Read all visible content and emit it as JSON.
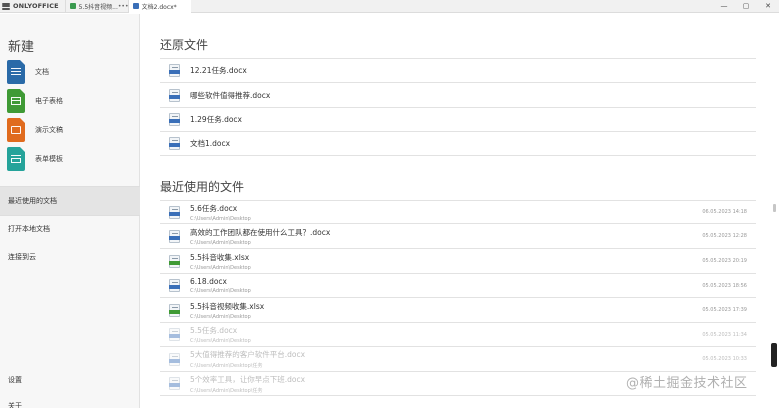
{
  "titlebar": {
    "brand": "ONLYOFFICE",
    "tabs": [
      {
        "label": "5.5抖音视频...",
        "close": "•••",
        "color": "#3a9a4f"
      },
      {
        "label": "文档2.docx*",
        "color": "#3a6fb8"
      }
    ],
    "window_controls": [
      "—",
      "▢",
      "✕"
    ]
  },
  "sidebar": {
    "title": "新建",
    "create_items": [
      {
        "label": "文档",
        "color": "#2a6aa8"
      },
      {
        "label": "电子表格",
        "color": "#3f9a35"
      },
      {
        "label": "演示文稿",
        "color": "#e06b1e"
      },
      {
        "label": "表单模板",
        "color": "#25a39a"
      }
    ],
    "nav": {
      "recent": "最近使用的文档",
      "open_local": "打开本地文档",
      "connect_cloud": "连接到云",
      "settings": "设置",
      "about": "关于"
    }
  },
  "main": {
    "restore_title": "还原文件",
    "restore_files": [
      {
        "name": "12.21任务.docx"
      },
      {
        "name": "哪些软件值得推荐.docx"
      },
      {
        "name": "1.29任务.docx"
      },
      {
        "name": "文档1.docx"
      }
    ],
    "recent_title": "最近使用的文件",
    "recent_files": [
      {
        "name": "5.6任务.docx",
        "path": "C:\\Users\\Admin\\Desktop",
        "date": "06.05.2023 14:18",
        "type": "doc",
        "faded": false
      },
      {
        "name": "高效的工作团队都在使用什么工具？.docx",
        "path": "C:\\Users\\Admin\\Desktop",
        "date": "05.05.2023 12:28",
        "type": "doc",
        "faded": false
      },
      {
        "name": "5.5抖音收集.xlsx",
        "path": "C:\\Users\\Admin\\Desktop",
        "date": "05.05.2023 20:19",
        "type": "xls",
        "faded": false
      },
      {
        "name": "6.18.docx",
        "path": "C:\\Users\\Admin\\Desktop",
        "date": "05.05.2023 18:56",
        "type": "doc",
        "faded": false
      },
      {
        "name": "5.5抖音视频收集.xlsx",
        "path": "C:\\Users\\Admin\\Desktop",
        "date": "05.05.2023 17:39",
        "type": "xls",
        "faded": false
      },
      {
        "name": "5.5任务.docx",
        "path": "C:\\Users\\Admin\\Desktop",
        "date": "05.05.2023 11:34",
        "type": "doc",
        "faded": true
      },
      {
        "name": "5大值得推荐的客户软件平台.docx",
        "path": "C:\\Users\\Admin\\Desktop\\任务",
        "date": "05.05.2023 10:33",
        "type": "doc",
        "faded": true
      },
      {
        "name": "5个效率工具，让你早点下班.docx",
        "path": "C:\\Users\\Admin\\Desktop\\任务",
        "date": "",
        "type": "doc",
        "faded": true
      }
    ]
  },
  "watermark": "@稀土掘金技术社区"
}
